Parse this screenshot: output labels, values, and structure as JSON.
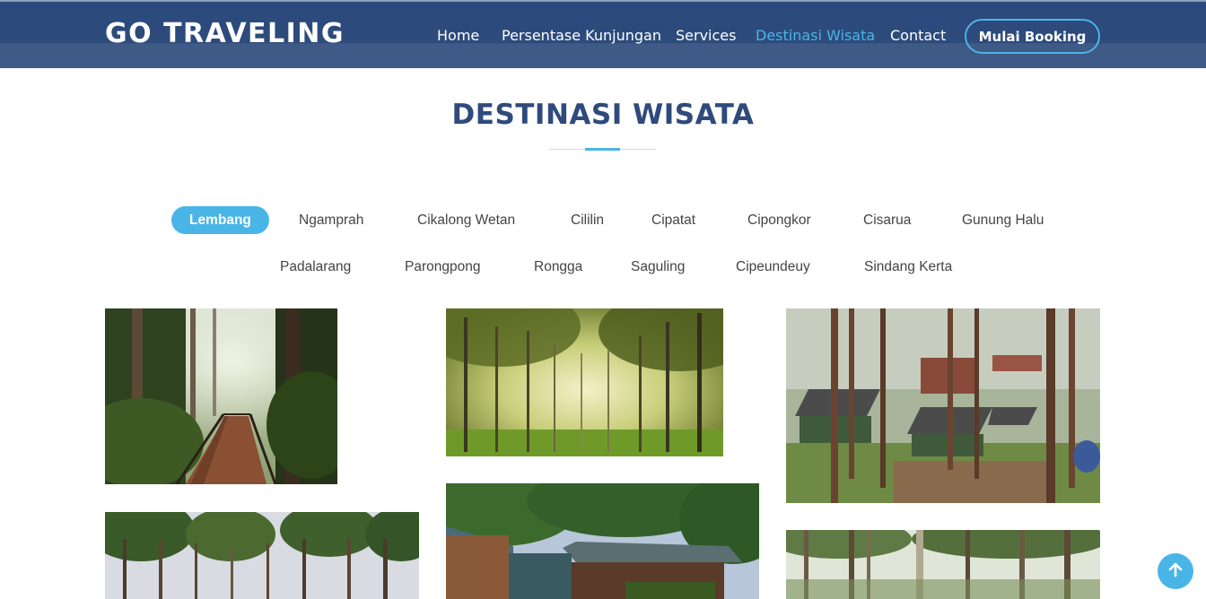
{
  "header": {
    "logo": "GO TRAVELING",
    "nav": [
      {
        "label": "Home",
        "active": false
      },
      {
        "label": "Persentase Kunjungan",
        "active": false
      },
      {
        "label": "Services",
        "active": false
      },
      {
        "label": "Destinasi Wisata",
        "active": true
      },
      {
        "label": "Contact",
        "active": false
      }
    ],
    "booking_label": "Mulai Booking"
  },
  "section": {
    "title": "DESTINASI WISATA"
  },
  "filters": {
    "row1": [
      "Lembang",
      "Ngamprah",
      "Cikalong Wetan",
      "Cililin",
      "Cipatat",
      "Cipongkor",
      "Cisarua",
      "Gunung Halu"
    ],
    "row2": [
      "Padalarang",
      "Parongpong",
      "Rongga",
      "Saguling",
      "Cipeundeuy",
      "Sindang Kerta"
    ],
    "active": "Lembang"
  },
  "gallery": {
    "icons": [
      "forest-boardwalk-photo",
      "misty-pine-forest-photo",
      "forest-campsite-photo",
      "pine-canopy-photo",
      "forest-cabin-photo",
      "pine-trunks-photo"
    ]
  },
  "back_to_top_icon": "arrow-up-icon",
  "colors": {
    "navy": "#2f4a7c",
    "accent": "#49b5e7"
  }
}
